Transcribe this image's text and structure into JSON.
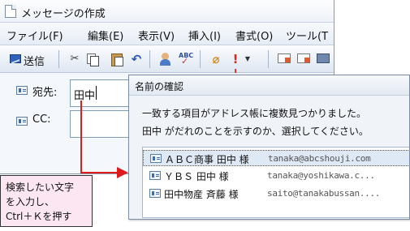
{
  "compose": {
    "title": "メッセージの作成",
    "menu": [
      {
        "label": "ファイル(F)",
        "name": "menu-file"
      },
      {
        "label": "編集(E)",
        "name": "menu-edit"
      },
      {
        "label": "表示(V)",
        "name": "menu-view"
      },
      {
        "label": "挿入(I)",
        "name": "menu-insert"
      },
      {
        "label": "書式(O)",
        "name": "menu-format"
      },
      {
        "label": "ツール(T",
        "name": "menu-tools"
      }
    ],
    "toolbar": {
      "send_label": "送信",
      "icons": [
        "send-icon",
        "cut-icon",
        "copy-icon",
        "paste-icon",
        "undo-icon",
        "address-book-icon",
        "spellcheck-icon",
        "attach-icon",
        "priority-icon",
        "dropdown-icon",
        "envelope-icon",
        "envelope-icon",
        "monitor-icon"
      ]
    },
    "to": {
      "label": "宛先:",
      "value": "田中"
    },
    "cc": {
      "label": "CC:",
      "value": ""
    }
  },
  "dialog": {
    "title": "名前の確認",
    "message1": "一致する項目がアドレス帳に複数見つかりました。",
    "message2": "田中 がだれのことを示すのか、選択してください。",
    "matches": [
      {
        "name": "ＡＢＣ商事 田中 様",
        "email": "tanaka@abcshouji.com"
      },
      {
        "name": "ＹＢＳ 田中 様",
        "email": "tanaka@yoshikawa.c..."
      },
      {
        "name": "田中物産 斉藤 様",
        "email": "saito@tanakabussan...."
      }
    ]
  },
  "callout": {
    "lines": [
      "検索したい文字",
      "を入力し、",
      "Ctrl＋Ｋを押す"
    ]
  },
  "colors": {
    "arrow": "#e01b1b",
    "callout_bg": "#fbe6f2",
    "selection": "#dfe8f5"
  }
}
